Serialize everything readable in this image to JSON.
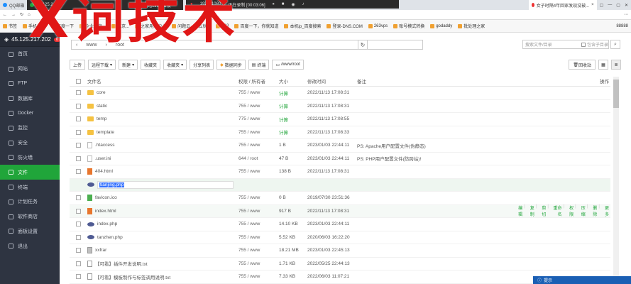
{
  "browser": {
    "tabs": [
      {
        "label": "QQ邮箱"
      },
      {
        "label": "45.125.2"
      },
      {
        "label": "宝塔Linux面板"
      }
    ],
    "right_tabs": [
      {
        "label": "女子时隔4年回家发现没被..."
      },
      {
        "label": ""
      }
    ],
    "recording": {
      "resolution": "1920x1080",
      "status": "正在录制 [00:03:06]"
    },
    "bookmarks": [
      "书签",
      "手机书签",
      "百度一下",
      "企业网盘...",
      "北京...",
      "之家用户中心",
      "问题云 - 上云就...",
      "263",
      "百度一下，你就知道",
      "本机ip_百度搜索",
      "登录-DNS.COM",
      "263vps",
      "账号模式转换",
      "godaddy",
      "批处理之家"
    ],
    "bookmark_count": "88888"
  },
  "sidebar": {
    "host": "45.125.217.202",
    "host_badge": "0",
    "items": [
      {
        "label": "首页",
        "icon": "home-icon",
        "active": false
      },
      {
        "label": "网站",
        "icon": "globe-icon",
        "active": false
      },
      {
        "label": "FTP",
        "icon": "ftp-icon",
        "active": false
      },
      {
        "label": "数据库",
        "icon": "database-icon",
        "active": false
      },
      {
        "label": "Docker",
        "icon": "docker-icon",
        "active": false
      },
      {
        "label": "监控",
        "icon": "monitor-icon",
        "active": false
      },
      {
        "label": "安全",
        "icon": "shield-icon",
        "active": false
      },
      {
        "label": "防火墙",
        "icon": "firewall-icon",
        "active": false
      },
      {
        "label": "文件",
        "icon": "folder-icon",
        "active": true
      },
      {
        "label": "终端",
        "icon": "terminal-icon",
        "active": false
      },
      {
        "label": "计划任务",
        "icon": "clock-icon",
        "active": false
      },
      {
        "label": "软件商店",
        "icon": "store-icon",
        "active": false
      },
      {
        "label": "面板设置",
        "icon": "gear-icon",
        "active": false
      },
      {
        "label": "退出",
        "icon": "logout-icon",
        "active": false
      }
    ]
  },
  "path": {
    "segments": [
      "www",
      "root"
    ],
    "search_placeholder": "搜索文件/目录",
    "include_sub": "包含子目录"
  },
  "toolbar": {
    "buttons": [
      "上传",
      "远程下载",
      "新建",
      "收藏夹",
      "收藏夹",
      "分享列表",
      "数据同步",
      "终端",
      "/www/root"
    ],
    "recycle": "回收站"
  },
  "table": {
    "headers": {
      "name": "文件名",
      "perm": "权限 / 所有者",
      "size": "大小",
      "time": "修改时间",
      "note": "备注",
      "op": "操作"
    },
    "rows": [
      {
        "type": "folder",
        "name": "core",
        "perm": "755 / www",
        "size": "计算",
        "time": "2022/11/13 17:08:31",
        "note": ""
      },
      {
        "type": "folder",
        "name": "static",
        "perm": "755 / www",
        "size": "计算",
        "time": "2022/11/13 17:08:31",
        "note": ""
      },
      {
        "type": "folder",
        "name": "temp",
        "perm": "775 / www",
        "size": "计算",
        "time": "2022/11/13 17:08:55",
        "note": ""
      },
      {
        "type": "folder",
        "name": "template",
        "perm": "755 / www",
        "size": "计算",
        "time": "2022/11/13 17:08:33",
        "note": ""
      },
      {
        "type": "file",
        "name": ".htaccess",
        "perm": "755 / www",
        "size": "1 B",
        "time": "2023/01/03 22:44:11",
        "note": "PS: Apache用户配置文件(伪静态)"
      },
      {
        "type": "file",
        "name": ".user.ini",
        "perm": "644 / root",
        "size": "47 B",
        "time": "2023/01/03 22:44:11",
        "note": "PS: PHP用户配置文件(防跨站)!"
      },
      {
        "type": "html",
        "name": "404.html",
        "perm": "755 / www",
        "size": "138 B",
        "time": "2022/11/13 17:08:31",
        "note": ""
      },
      {
        "type": "php",
        "name": "tianjing.php",
        "perm": "",
        "size": "",
        "time": "",
        "note": "",
        "renaming": true
      },
      {
        "type": "ico",
        "name": "favicon.ico",
        "perm": "755 / www",
        "size": "0 B",
        "time": "2019/07/30 23:51:36",
        "note": ""
      },
      {
        "type": "html",
        "name": "index.html",
        "perm": "755 / www",
        "size": "917 B",
        "time": "2022/11/13 17:08:31",
        "note": "",
        "hover": true
      },
      {
        "type": "php",
        "name": "index.php",
        "perm": "755 / www",
        "size": "14.10 KB",
        "time": "2023/01/03 22:44:11",
        "note": ""
      },
      {
        "type": "php",
        "name": "tanzhen.php",
        "perm": "755 / www",
        "size": "5.52 KB",
        "time": "2020/06/03 16:22:20",
        "note": ""
      },
      {
        "type": "zip",
        "name": "xxfrar",
        "perm": "755 / www",
        "size": "18.21 MB",
        "time": "2023/01/03 22:45:13",
        "note": ""
      },
      {
        "type": "txt",
        "name": "【可看】插件开发说明.txt",
        "perm": "755 / www",
        "size": "1.71 KB",
        "time": "2022/05/25 22:44:13",
        "note": ""
      },
      {
        "type": "txt",
        "name": "【可看】模板制作与标签调用说明.txt",
        "perm": "755 / www",
        "size": "7.33 KB",
        "time": "2022/06/03 11:07:21",
        "note": ""
      }
    ],
    "row_ops": [
      "编辑",
      "复制",
      "剪切",
      "重命名",
      "权限",
      "压缩",
      "删除",
      "更多"
    ]
  },
  "banner": {
    "label": "提示"
  },
  "watermark": "X词技术",
  "colors": {
    "accent": "#20a53a",
    "sidebar": "#2e3441",
    "watermark": "#e01616"
  }
}
